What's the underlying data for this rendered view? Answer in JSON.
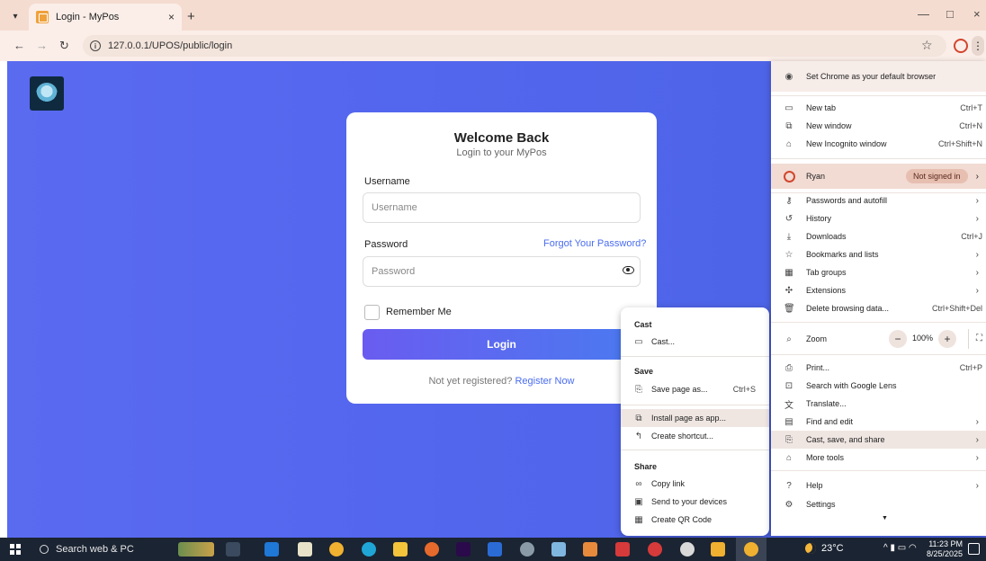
{
  "browser": {
    "tab_title": "Login - MyPos",
    "tab_close": "×",
    "new_tab": "+",
    "url": "127.0.0.1/UPOS/public/login",
    "minimize": "—",
    "maximize": "□",
    "close": "×"
  },
  "login": {
    "title": "Welcome Back",
    "subtitle": "Login to your MyPos",
    "username_label": "Username",
    "username_placeholder": "Username",
    "password_label": "Password",
    "password_placeholder": "Password",
    "forgot": "Forgot Your Password?",
    "remember": "Remember Me",
    "login_button": "Login",
    "register_prompt": "Not yet registered?",
    "register_link": "Register Now"
  },
  "submenu": {
    "cast_header": "Cast",
    "cast": "Cast...",
    "save_header": "Save",
    "save_page": "Save page as...",
    "save_shortcut": "Ctrl+S",
    "install": "Install page as app...",
    "shortcut": "Create shortcut...",
    "share_header": "Share",
    "copy_link": "Copy link",
    "send": "Send to your devices",
    "qr": "Create QR Code"
  },
  "menu": {
    "default_browser": "Set Chrome as your default browser",
    "new_tab": "New tab",
    "new_tab_sc": "Ctrl+T",
    "new_window": "New window",
    "new_window_sc": "Ctrl+N",
    "incognito": "New Incognito window",
    "incognito_sc": "Ctrl+Shift+N",
    "profile_name": "Ryan",
    "not_signed": "Not signed in",
    "passwords": "Passwords and autofill",
    "history": "History",
    "downloads": "Downloads",
    "downloads_sc": "Ctrl+J",
    "bookmarks": "Bookmarks and lists",
    "tab_groups": "Tab groups",
    "extensions": "Extensions",
    "delete_data": "Delete browsing data...",
    "delete_data_sc": "Ctrl+Shift+Del",
    "zoom": "Zoom",
    "zoom_value": "100%",
    "zoom_minus": "−",
    "zoom_plus": "+",
    "print": "Print...",
    "print_sc": "Ctrl+P",
    "lens": "Search with Google Lens",
    "translate": "Translate...",
    "find_edit": "Find and edit",
    "cast_save_share": "Cast, save, and share",
    "more_tools": "More tools",
    "help": "Help",
    "settings": "Settings"
  },
  "taskbar": {
    "search": "Search web & PC",
    "temperature": "23°C",
    "time": "11:23 PM",
    "date": "8/25/2025"
  }
}
